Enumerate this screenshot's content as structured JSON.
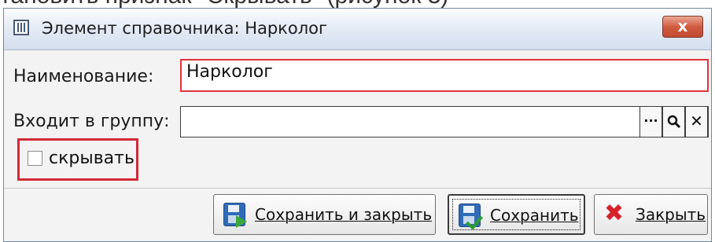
{
  "background_text": "тановить признак \"Скрывать\" (рисунок 3)",
  "window": {
    "title": "Элемент справочника: Нарколог",
    "close_glyph": "x"
  },
  "form": {
    "name_label": "Наименование:",
    "name_value": "Нарколог",
    "group_label": "Входит в группу:",
    "group_value": "",
    "group_buttons": [
      "···",
      "🔍",
      "✕"
    ],
    "hide_checkbox": {
      "label": "скрывать",
      "checked": false
    }
  },
  "actions": {
    "save_close": "Сохранить и закрыть",
    "save": "Сохранить",
    "close": "Закрыть"
  },
  "colors": {
    "highlight_red": "#e0343c",
    "title_bar": "#dfe8f3",
    "close_button": "#d05c41"
  }
}
